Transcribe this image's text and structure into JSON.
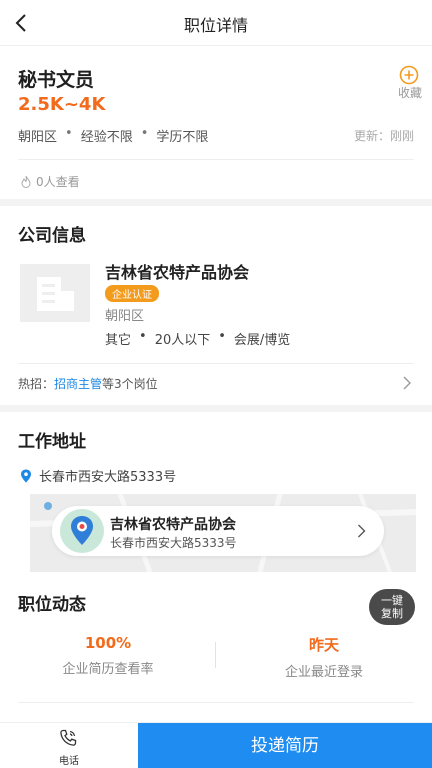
{
  "nav": {
    "title": "职位详情"
  },
  "job": {
    "title": "秘书文员",
    "salary": "2.5K~4K",
    "fav_label": "收藏",
    "meta": [
      "朝阳区",
      "经验不限",
      "学历不限"
    ],
    "meta_sep": "•",
    "update_label": "更新：",
    "update_value": "刚刚",
    "views": "0人查看"
  },
  "company": {
    "section_title": "公司信息",
    "name": "吉林省农特产品协会",
    "cert": "企业认证",
    "district": "朝阳区",
    "tags": [
      "其它",
      "20人以下",
      "会展/博览"
    ],
    "hot_prefix": "热招：",
    "hot_job": "招商主管",
    "hot_suffix": "等3个岗位"
  },
  "address": {
    "section_title": "工作地址",
    "text": "长春市西安大路5333号",
    "map_card_name": "吉林省农特产品协会",
    "map_card_addr": "长春市西安大路5333号"
  },
  "dynamic": {
    "section_title": "职位动态",
    "copy_btn_line1": "一键",
    "copy_btn_line2": "复制",
    "stats": [
      {
        "value": "100%",
        "label": "企业简历查看率"
      },
      {
        "value": "昨天",
        "label": "企业最近登录"
      }
    ]
  },
  "bottom": {
    "phone_label": "电话",
    "apply_label": "投递简历"
  },
  "colors": {
    "accent_orange": "#f26b1d",
    "primary_blue": "#1e8cf0",
    "badge_orange": "#f39b1d"
  }
}
